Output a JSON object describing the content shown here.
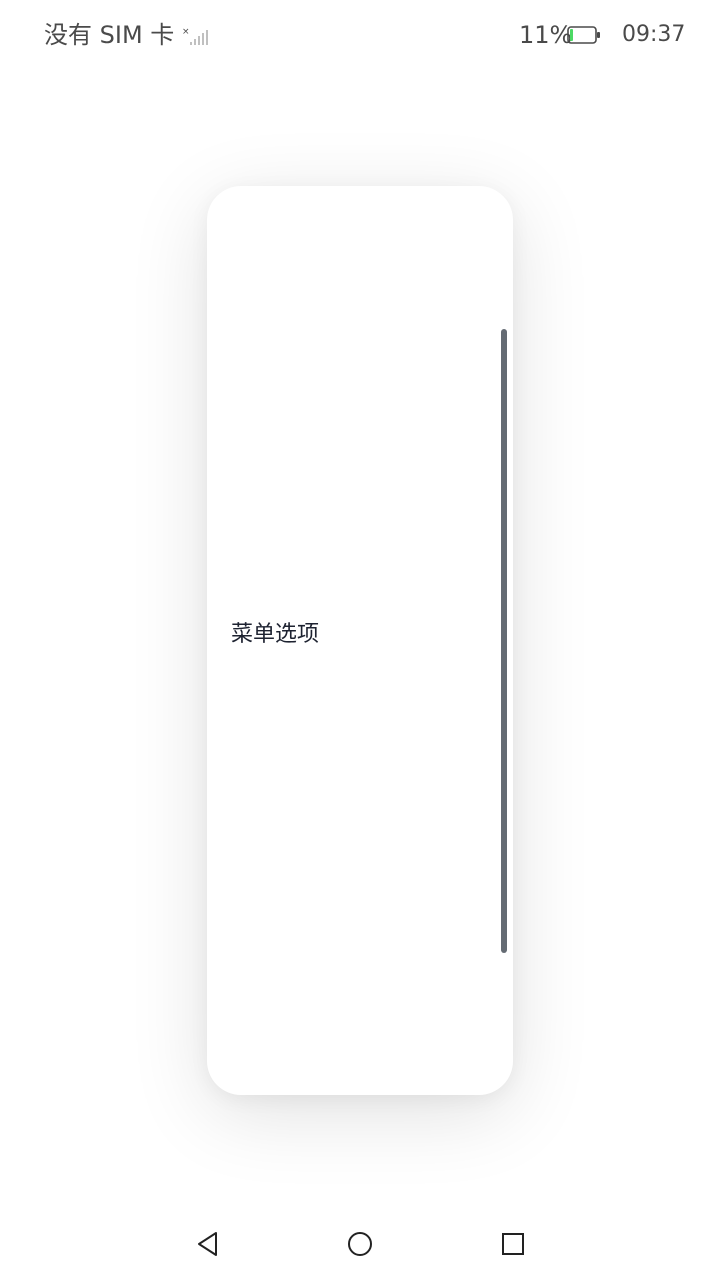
{
  "status_bar": {
    "carrier": "没有 SIM 卡",
    "battery_percent": "11%",
    "battery_level": 0.11,
    "time": "09:37"
  },
  "menu": {
    "item_label": "菜单选项"
  },
  "navigation": {
    "icons": [
      "back-triangle-icon",
      "home-circle-icon",
      "recent-square-icon"
    ]
  },
  "colors": {
    "background": "#ffffff",
    "text_primary": "#1d2230",
    "status_text": "#4a4a4a",
    "scrollbar": "#646b73",
    "battery_level": "#4cd964"
  }
}
